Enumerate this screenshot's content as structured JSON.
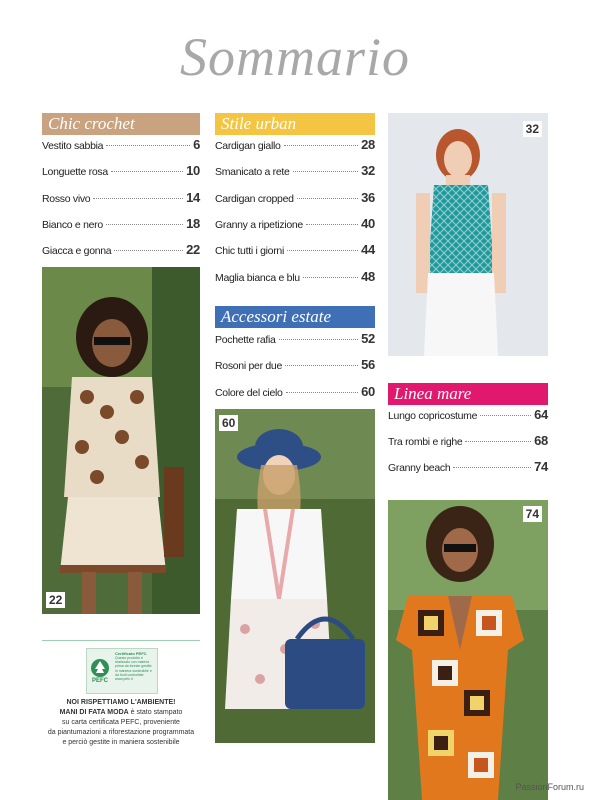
{
  "title": "Sommario",
  "sections": {
    "chic": {
      "heading": "Chic crochet",
      "color": "#c9a27f",
      "items": [
        {
          "label": "Vestito sabbia",
          "page": "6"
        },
        {
          "label": "Longuette rosa",
          "page": "10"
        },
        {
          "label": "Rosso vivo",
          "page": "14"
        },
        {
          "label": "Bianco e nero",
          "page": "18"
        },
        {
          "label": "Giacca e gonna",
          "page": "22"
        }
      ]
    },
    "urban": {
      "heading": "Stile urban",
      "color": "#f4c542",
      "items": [
        {
          "label": "Cardigan giallo",
          "page": "28"
        },
        {
          "label": "Smanicato a rete",
          "page": "32"
        },
        {
          "label": "Cardigan cropped",
          "page": "36"
        },
        {
          "label": "Granny a ripetizione",
          "page": "40"
        },
        {
          "label": "Chic tutti i giorni",
          "page": "44"
        },
        {
          "label": "Maglia bianca e blu",
          "page": "48"
        }
      ]
    },
    "accessori": {
      "heading": "Accessori estate",
      "color": "#3f6fb5",
      "items": [
        {
          "label": "Pochette rafia",
          "page": "52"
        },
        {
          "label": "Rosoni per due",
          "page": "56"
        },
        {
          "label": "Colore del cielo",
          "page": "60"
        }
      ]
    },
    "mare": {
      "heading": "Linea mare",
      "color": "#e0186e",
      "items": [
        {
          "label": "Lungo copricostume",
          "page": "64"
        },
        {
          "label": "Tra rombi e righe",
          "page": "68"
        },
        {
          "label": "Granny beach",
          "page": "74"
        }
      ]
    }
  },
  "photos": {
    "p22": "22",
    "p32": "32",
    "p60": "60",
    "p74": "74"
  },
  "pefc": {
    "logo_text": "PEFC",
    "cert_title": "Certificato PEFC",
    "cert_body": "Questo prodotto è realizzato con materia prima da foreste gestite in maniera sostenibile e da fonti controllate",
    "cert_url": "www.pefc.it"
  },
  "eco": {
    "line1": "NOI RISPETTIAMO L'AMBIENTE!",
    "brand": "MANI DI FATA MODA",
    "rest1": " è stato stampato",
    "line3": "su carta certificata PEFC, proveniente",
    "line4": "da piantumazioni a riforestazione programmata",
    "line5": "e perciò gestite in maniera sostenibile"
  },
  "credit": "PassionForum.ru"
}
